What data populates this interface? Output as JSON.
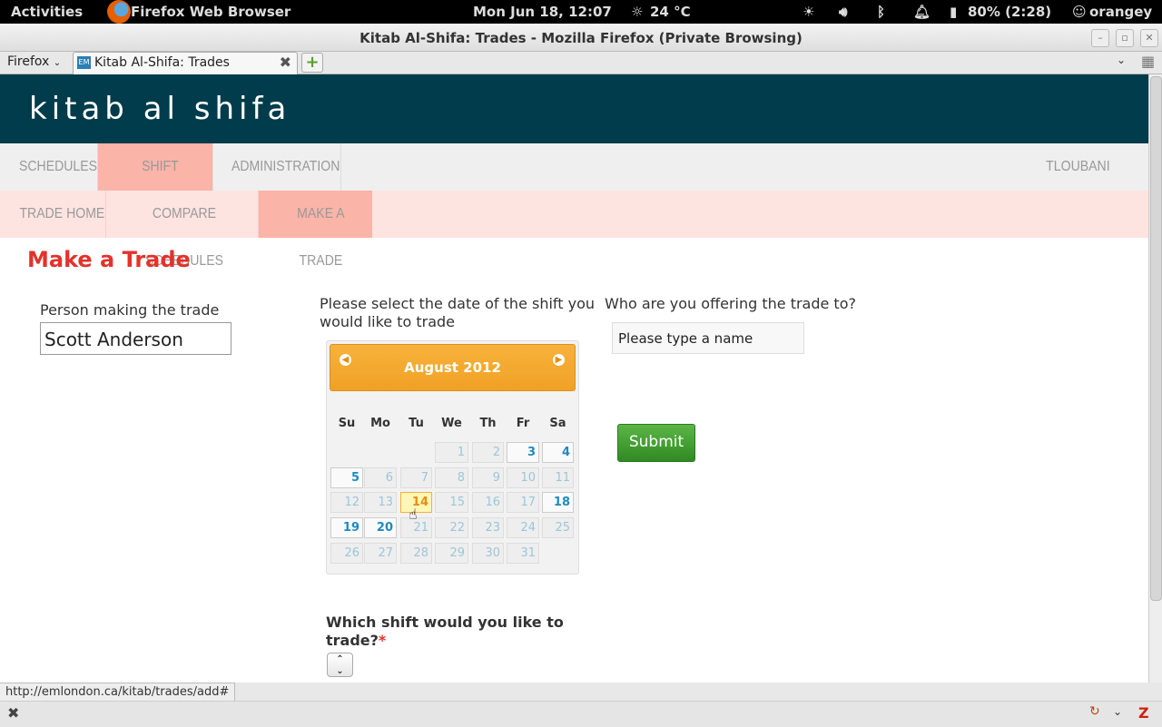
{
  "system_bar": {
    "activities": "Activities",
    "app_name": "Firefox Web Browser",
    "datetime": "Mon Jun 18, 12:07",
    "weather": "24 °C",
    "battery": "80% (2:28)",
    "user": "orangey"
  },
  "window": {
    "title": "Kitab Al-Shifa: Trades - Mozilla Firefox (Private Browsing)"
  },
  "browser": {
    "menu_label": "Firefox",
    "tab_title": "Kitab Al-Shifa: Trades",
    "favicon_text": "EM",
    "status_url": "http://emlondon.ca/kitab/trades/add#"
  },
  "site": {
    "logo": "kitab al shifa",
    "nav_primary": [
      "SCHEDULES",
      "SHIFT TRADING",
      "ADMINISTRATION"
    ],
    "logout": "TLOUBANI (LOGOUT)",
    "nav_secondary": [
      "TRADE HOME",
      "COMPARE SCHEDULES",
      "MAKE A TRADE"
    ]
  },
  "form": {
    "heading": "Make a Trade",
    "person_label": "Person making the trade",
    "person_value": "Scott Anderson",
    "date_label_line1": "Please select the date of the shift you",
    "date_label_line2": "would like to trade",
    "offer_label": "Who are you offering the trade to?",
    "offer_placeholder": "Please type a name",
    "submit_label": "Submit",
    "shift_label_line1": "Which shift would you like to",
    "shift_label_line2": "trade?",
    "required_mark": "*"
  },
  "calendar": {
    "month": "August 2012",
    "weekdays": [
      "Su",
      "Mo",
      "Tu",
      "We",
      "Th",
      "Fr",
      "Sa"
    ],
    "first_weekday_index": 3,
    "days_in_month": 31,
    "selectable_days": [
      3,
      4,
      5,
      18,
      19,
      20
    ],
    "highlighted_day": 14
  },
  "colors": {
    "header_bg": "#003c4b",
    "active_nav_bg": "#fbb4a8",
    "heading_red": "#e4322b",
    "calendar_orange": "#f0a125",
    "submit_green": "#3e9b2f"
  }
}
